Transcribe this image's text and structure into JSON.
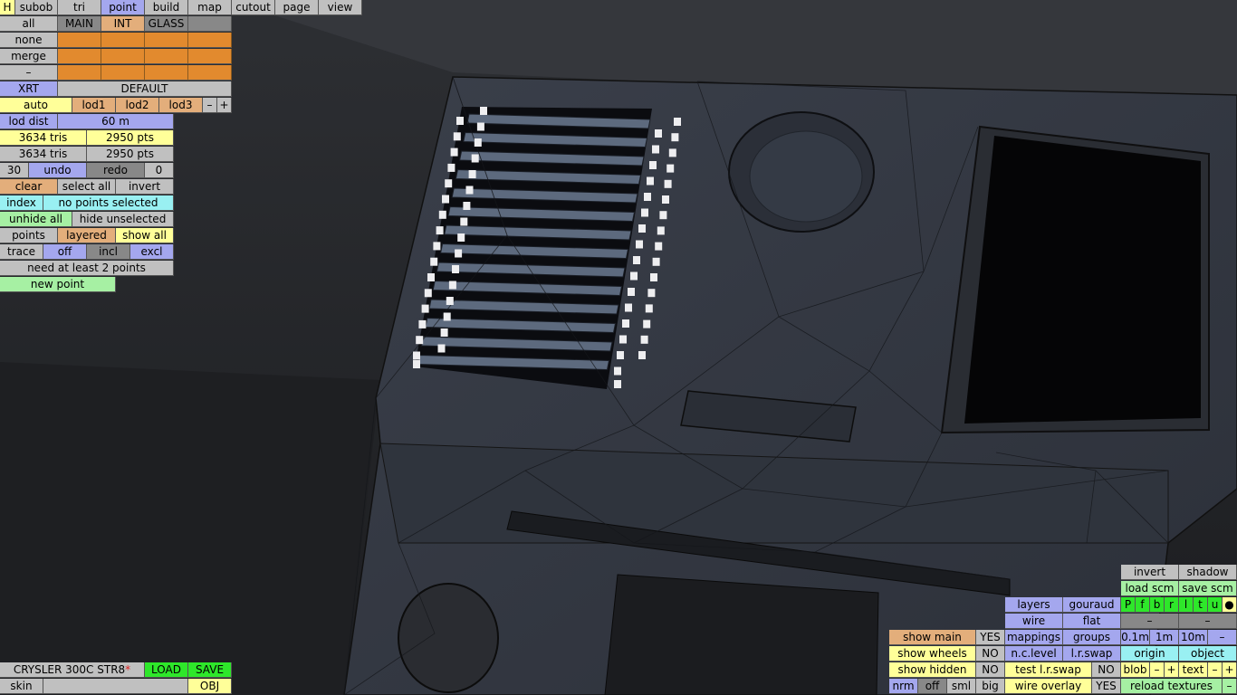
{
  "menu": {
    "h": "H",
    "tabs": [
      "subob",
      "tri",
      "point",
      "build",
      "map",
      "cutout",
      "page",
      "view"
    ],
    "active_tab": "point"
  },
  "left": {
    "all": "all",
    "main": "MAIN",
    "int": "INT",
    "glass": "GLASS",
    "none": "none",
    "merge": "merge",
    "dash": "–",
    "xrt": "XRT",
    "default": "DEFAULT",
    "auto": "auto",
    "lod1": "lod1",
    "lod2": "lod2",
    "lod3": "lod3",
    "minus": "–",
    "plus": "+",
    "lod_dist": "lod dist",
    "lod_dist_value": "60 m",
    "tris1": "3634 tris",
    "pts1": "2950 pts",
    "tris2": "3634 tris",
    "pts2": "2950 pts",
    "undo_count": "30",
    "undo": "undo",
    "redo": "redo",
    "redo_count": "0",
    "clear": "clear",
    "select_all": "select all",
    "invert": "invert",
    "index": "index",
    "selection_status": "no points selected",
    "unhide_all": "unhide all",
    "hide_unselected": "hide unselected",
    "points": "points",
    "layered": "layered",
    "show_all": "show all",
    "trace": "trace",
    "off": "off",
    "incl": "incl",
    "excl": "excl",
    "need_points": "need at least 2 points",
    "new_point": "new point"
  },
  "bottom_left": {
    "car_name": "CRYSLER 300C STR8",
    "modified_mark": "*",
    "load": "LOAD",
    "save": "SAVE",
    "skin": "skin",
    "obj": "OBJ"
  },
  "bottom_right": {
    "invert": "invert",
    "shadow": "shadow",
    "load_scm": "load scm",
    "save_scm": "save scm",
    "layers": "layers",
    "gouraud": "gouraud",
    "flags": [
      "P",
      "f",
      "b",
      "r",
      "l",
      "t",
      "u",
      "●"
    ],
    "wire": "wire",
    "flat": "flat",
    "dash1": "–",
    "dash2": "–",
    "show_main": "show main",
    "show_main_val": "YES",
    "mappings": "mappings",
    "groups": "groups",
    "d01": "0.1m",
    "d1": "1m",
    "d10": "10m",
    "dminus": "–",
    "show_wheels": "show wheels",
    "show_wheels_val": "NO",
    "nc_level": "n.c.level",
    "lr_swap": "l.r.swap",
    "origin": "origin",
    "object": "object",
    "show_hidden": "show hidden",
    "show_hidden_val": "NO",
    "test_lr_swap": "test l.r.swap",
    "test_lr_swap_val": "NO",
    "blob": "blob",
    "blob_minus": "–",
    "blob_plus": "+",
    "text": "text",
    "text_minus": "–",
    "text_plus": "+",
    "nrm": "nrm",
    "off": "off",
    "sml": "sml",
    "big": "big",
    "wire_overlay": "wire overlay",
    "wire_overlay_val": "YES",
    "reload_textures": "reload textures",
    "reload_minus": "–"
  }
}
